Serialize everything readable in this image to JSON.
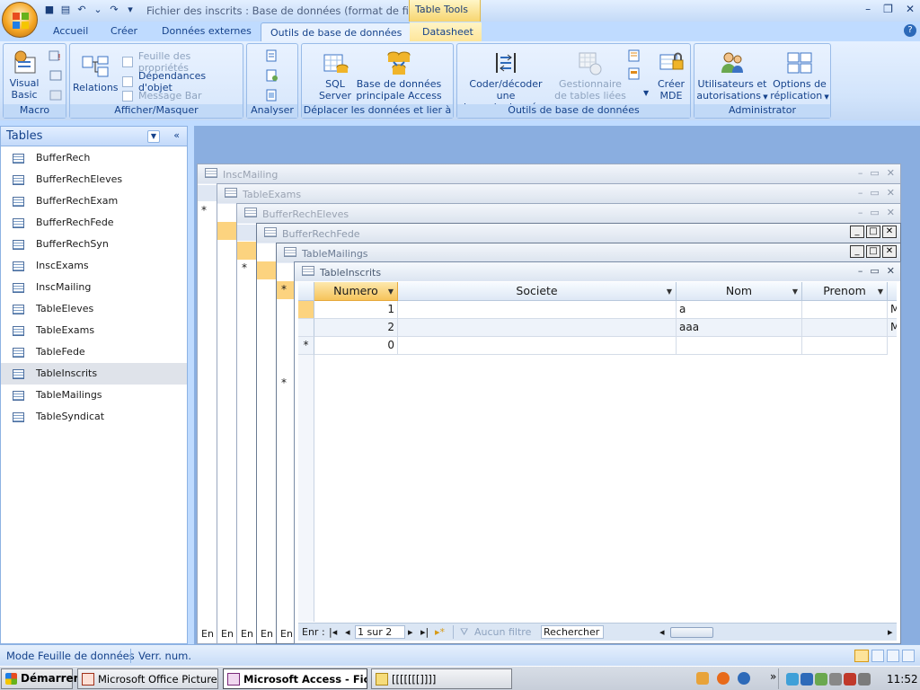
{
  "window": {
    "title": "Fichier des inscrits : Base de données (format de fichi...",
    "context_tab_group": "Table Tools"
  },
  "ribbon_tabs": [
    "Accueil",
    "Créer",
    "Données externes",
    "Outils de base de données",
    "Datasheet"
  ],
  "active_tab": "Outils de base de données",
  "groups": {
    "macro": {
      "label": "Macro",
      "visual_basic": [
        "Visual",
        "Basic"
      ]
    },
    "afficher": {
      "label": "Afficher/Masquer",
      "relations": "Relations",
      "feuille_props": "Feuille des propriétés",
      "dependances": "Dépendances d'objet",
      "message_bar": "Message Bar"
    },
    "analyser": {
      "label": "Analyser"
    },
    "deplacer": {
      "label": "Déplacer les données et lier à",
      "sql": [
        "SQL",
        "Server"
      ],
      "access": [
        "Base de données",
        "principale Access"
      ]
    },
    "outils": {
      "label": "Outils de base de données",
      "coder": [
        "Coder/décoder une",
        "base de données"
      ],
      "gestionnaire": [
        "Gestionnaire",
        "de tables liées"
      ],
      "creer_mde": [
        "Créer",
        "MDE"
      ]
    },
    "admin": {
      "label": "Administrator",
      "utilisateurs": [
        "Utilisateurs et",
        "autorisations"
      ],
      "options": [
        "Options de",
        "réplication"
      ]
    }
  },
  "nav_pane": {
    "title": "Tables",
    "items": [
      "BufferRech",
      "BufferRechEleves",
      "BufferRechExam",
      "BufferRechFede",
      "BufferRechSyn",
      "InscExams",
      "InscMailing",
      "TableEleves",
      "TableExams",
      "TableFede",
      "TableInscrits",
      "TableMailings",
      "TableSyndicat"
    ],
    "selected": "TableInscrits"
  },
  "background_windows": [
    "InscMailing",
    "TableExams",
    "BufferRechEleves",
    "BufferRechFede",
    "TableMailings"
  ],
  "en_label": "En",
  "datasheet": {
    "title": "TableInscrits",
    "columns": [
      "Numero",
      "Societe",
      "Nom",
      "Prenom"
    ],
    "rows": [
      {
        "Numero": "1",
        "Societe": "",
        "Nom": "a",
        "Prenom": "",
        "extra": "M"
      },
      {
        "Numero": "2",
        "Societe": "",
        "Nom": "aaa",
        "Prenom": "",
        "extra": "M"
      }
    ],
    "new_row_numero": "0",
    "new_row_marker": "*",
    "navigator": {
      "label": "Enr :",
      "position": "1 sur 2",
      "filter": "Aucun filtre",
      "search": "Rechercher"
    }
  },
  "status_bar": {
    "mode": "Mode Feuille de données",
    "num_lock": "Verr. num."
  },
  "taskbar": {
    "start": "Démarrer",
    "buttons": [
      "Microsoft Office Picture ...",
      "Microsoft Access - Fic...",
      "[[[[[[[]]]]"
    ],
    "clock": "11:52"
  },
  "colors": {
    "accent": "#15428b",
    "selected_header": "#f6c45b",
    "mdi_background": "#8aaee0"
  }
}
